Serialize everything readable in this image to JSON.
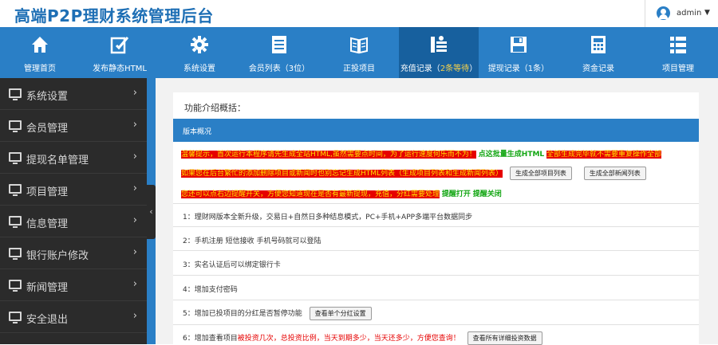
{
  "header": {
    "brand": "高端P2P理财系统管理后台",
    "user": "admin",
    "caret": "▼"
  },
  "nav": {
    "items": [
      {
        "label": "管理首页",
        "icon": "home-icon"
      },
      {
        "label": "发布静态HTML",
        "icon": "edit-icon"
      },
      {
        "label": "系统设置",
        "icon": "gear-icon"
      },
      {
        "label": "会员列表（3位）",
        "icon": "list-icon"
      },
      {
        "label": "正投项目",
        "icon": "book-icon"
      },
      {
        "label_prefix": "充值记录（",
        "label_highlight": "2条等待",
        "label_suffix": "）",
        "icon": "stack-icon"
      },
      {
        "label": "提现记录（1条）",
        "icon": "floppy-icon"
      },
      {
        "label": "资金记录",
        "icon": "calculator-icon"
      },
      {
        "label": "项目管理",
        "icon": "list-detail-icon"
      }
    ]
  },
  "sidebar": {
    "items": [
      {
        "label": "系统设置"
      },
      {
        "label": "会员管理"
      },
      {
        "label": "提现名单管理"
      },
      {
        "label": "项目管理"
      },
      {
        "label": "信息管理"
      },
      {
        "label": "银行账户修改"
      },
      {
        "label": "新闻管理"
      },
      {
        "label": "安全退出"
      }
    ],
    "arrow": "›",
    "collapse": "‹"
  },
  "panel": {
    "title": "功能介绍概括：",
    "section": "版本概况",
    "notice1": "温馨提示，首次运行本程序请先生成全站HTML,虽然需要点时间，为了运行速度何乐而不为！",
    "notice1_green": "点这批量生成HTML",
    "notice1_tail": "全部生成完毕就不需要重复操作全部",
    "notice2": "如果您在后台繁忙的添加删除项目或新闻时也别忘记生成HTML列表（生成项目列表和生成新闻列表）",
    "btn_projects": "生成全部项目列表",
    "btn_news": "生成全部新闻列表",
    "notice3": "您还可以点右边提醒开关，方便您知道现在是否有最新提现，充值，分红需要处理",
    "remind_on": "提醒打开",
    "remind_off": "提醒关闭",
    "rows": [
      "1：理财网版本全新升级，交易日+自然日多种结息模式，PC+手机+APP多端平台数据同步",
      "2：手机注册 短信接收 手机号码就可以登陆",
      "3：实名认证后可以绑定银行卡",
      "4：增加支付密码",
      "5：增加已投项目的分红是否暂停功能",
      "6：增加查看项目"
    ],
    "row5_btn": "查看单个分红设置",
    "row6_red": "被投资几次，总投资比例，当天到期多少，当天还多少，方便您查询！",
    "row6_btn": "查看所有详细投资数据"
  },
  "colors": {
    "accent": "#2a7fc6",
    "active_nav": "#17609e",
    "sidebar": "#2b2b2b",
    "notice_bg": "#e60000",
    "notice_text": "#ffe100",
    "green": "#12a612"
  }
}
